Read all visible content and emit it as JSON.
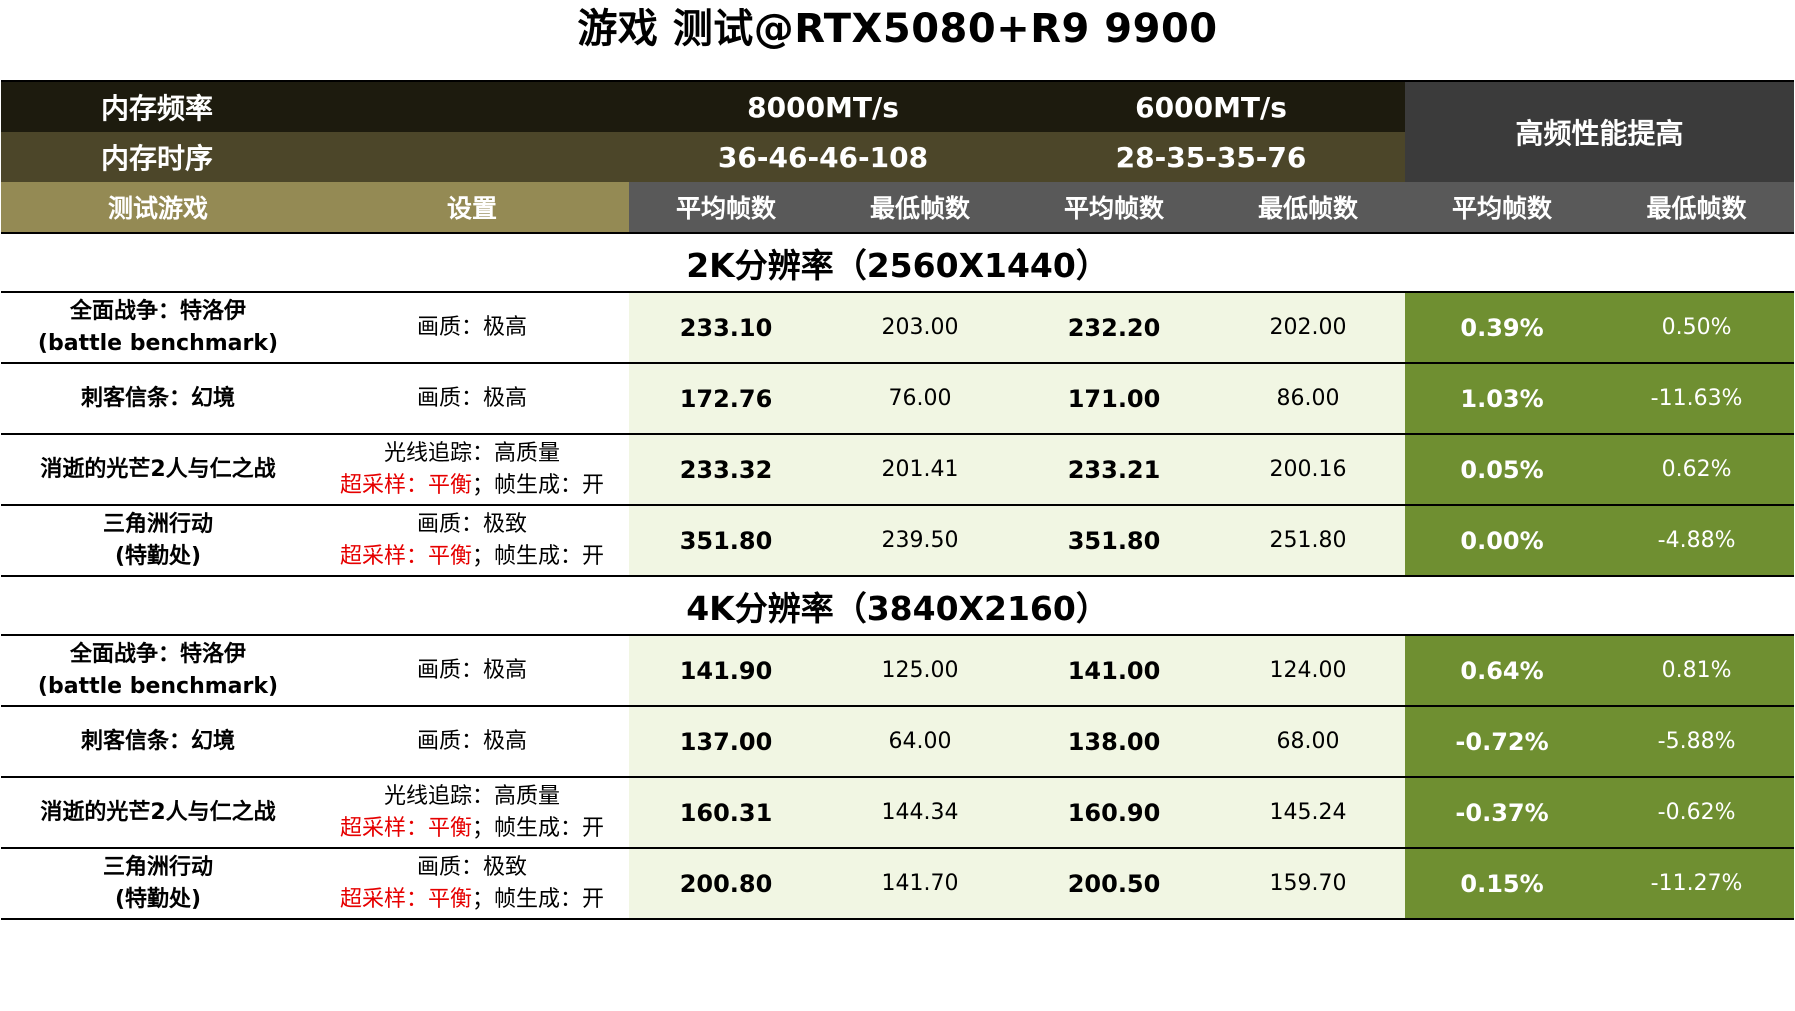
{
  "title": "游戏 测试@RTX5080+R9 9900",
  "header": {
    "freq_label": "内存频率",
    "timing_label": "内存时序",
    "config_a": {
      "freq": "8000MT/s",
      "timing": "36-46-46-108"
    },
    "config_b": {
      "freq": "6000MT/s",
      "timing": "28-35-35-76"
    },
    "boost_label": "高频性能提高",
    "col_game": "测试游戏",
    "col_setting": "设置",
    "col_avg": "平均帧数",
    "col_min": "最低帧数"
  },
  "colors": {
    "header_dark": "#1d1b0e",
    "header_olive": "#4c4629",
    "header_gold": "#948a54",
    "header_grey": "#595959",
    "boost_dark": "#3b3b3b",
    "cell_light_green": "#f1f6e3",
    "cell_green": "#6f8f31",
    "setting_red": "#e60000"
  },
  "sections": [
    {
      "title": "2K分辨率（2560X1440）",
      "rows": [
        {
          "game_l1": "全面战争：特洛伊",
          "game_l2": "(battle benchmark)",
          "set_l1": "画质：极高",
          "set_l2_red": "",
          "set_l2_black": "",
          "a_avg": "233.10",
          "a_min": "203.00",
          "b_avg": "232.20",
          "b_min": "202.00",
          "d_avg": "0.39%",
          "d_min": "0.50%"
        },
        {
          "game_l1": "刺客信条：幻境",
          "game_l2": "",
          "set_l1": "画质：极高",
          "set_l2_red": "",
          "set_l2_black": "",
          "a_avg": "172.76",
          "a_min": "76.00",
          "b_avg": "171.00",
          "b_min": "86.00",
          "d_avg": "1.03%",
          "d_min": "-11.63%"
        },
        {
          "game_l1": "消逝的光芒2人与仁之战",
          "game_l2": "",
          "set_l1": "光线追踪：高质量",
          "set_l2_red": "超采样：平衡",
          "set_l2_black": "；帧生成：开",
          "a_avg": "233.32",
          "a_min": "201.41",
          "b_avg": "233.21",
          "b_min": "200.16",
          "d_avg": "0.05%",
          "d_min": "0.62%"
        },
        {
          "game_l1": "三角洲行动",
          "game_l2": "(特勤处)",
          "set_l1": "画质：极致",
          "set_l2_red": "超采样：平衡",
          "set_l2_black": "；帧生成：开",
          "a_avg": "351.80",
          "a_min": "239.50",
          "b_avg": "351.80",
          "b_min": "251.80",
          "d_avg": "0.00%",
          "d_min": "-4.88%"
        }
      ]
    },
    {
      "title": "4K分辨率（3840X2160）",
      "rows": [
        {
          "game_l1": "全面战争：特洛伊",
          "game_l2": "(battle benchmark)",
          "set_l1": "画质：极高",
          "set_l2_red": "",
          "set_l2_black": "",
          "a_avg": "141.90",
          "a_min": "125.00",
          "b_avg": "141.00",
          "b_min": "124.00",
          "d_avg": "0.64%",
          "d_min": "0.81%"
        },
        {
          "game_l1": "刺客信条：幻境",
          "game_l2": "",
          "set_l1": "画质：极高",
          "set_l2_red": "",
          "set_l2_black": "",
          "a_avg": "137.00",
          "a_min": "64.00",
          "b_avg": "138.00",
          "b_min": "68.00",
          "d_avg": "-0.72%",
          "d_min": "-5.88%"
        },
        {
          "game_l1": "消逝的光芒2人与仁之战",
          "game_l2": "",
          "set_l1": "光线追踪：高质量",
          "set_l2_red": "超采样：平衡",
          "set_l2_black": "；帧生成：开",
          "a_avg": "160.31",
          "a_min": "144.34",
          "b_avg": "160.90",
          "b_min": "145.24",
          "d_avg": "-0.37%",
          "d_min": "-0.62%"
        },
        {
          "game_l1": "三角洲行动",
          "game_l2": "(特勤处)",
          "set_l1": "画质：极致",
          "set_l2_red": "超采样：平衡",
          "set_l2_black": "；帧生成：开",
          "a_avg": "200.80",
          "a_min": "141.70",
          "b_avg": "200.50",
          "b_min": "159.70",
          "d_avg": "0.15%",
          "d_min": "-11.27%"
        }
      ]
    }
  ]
}
